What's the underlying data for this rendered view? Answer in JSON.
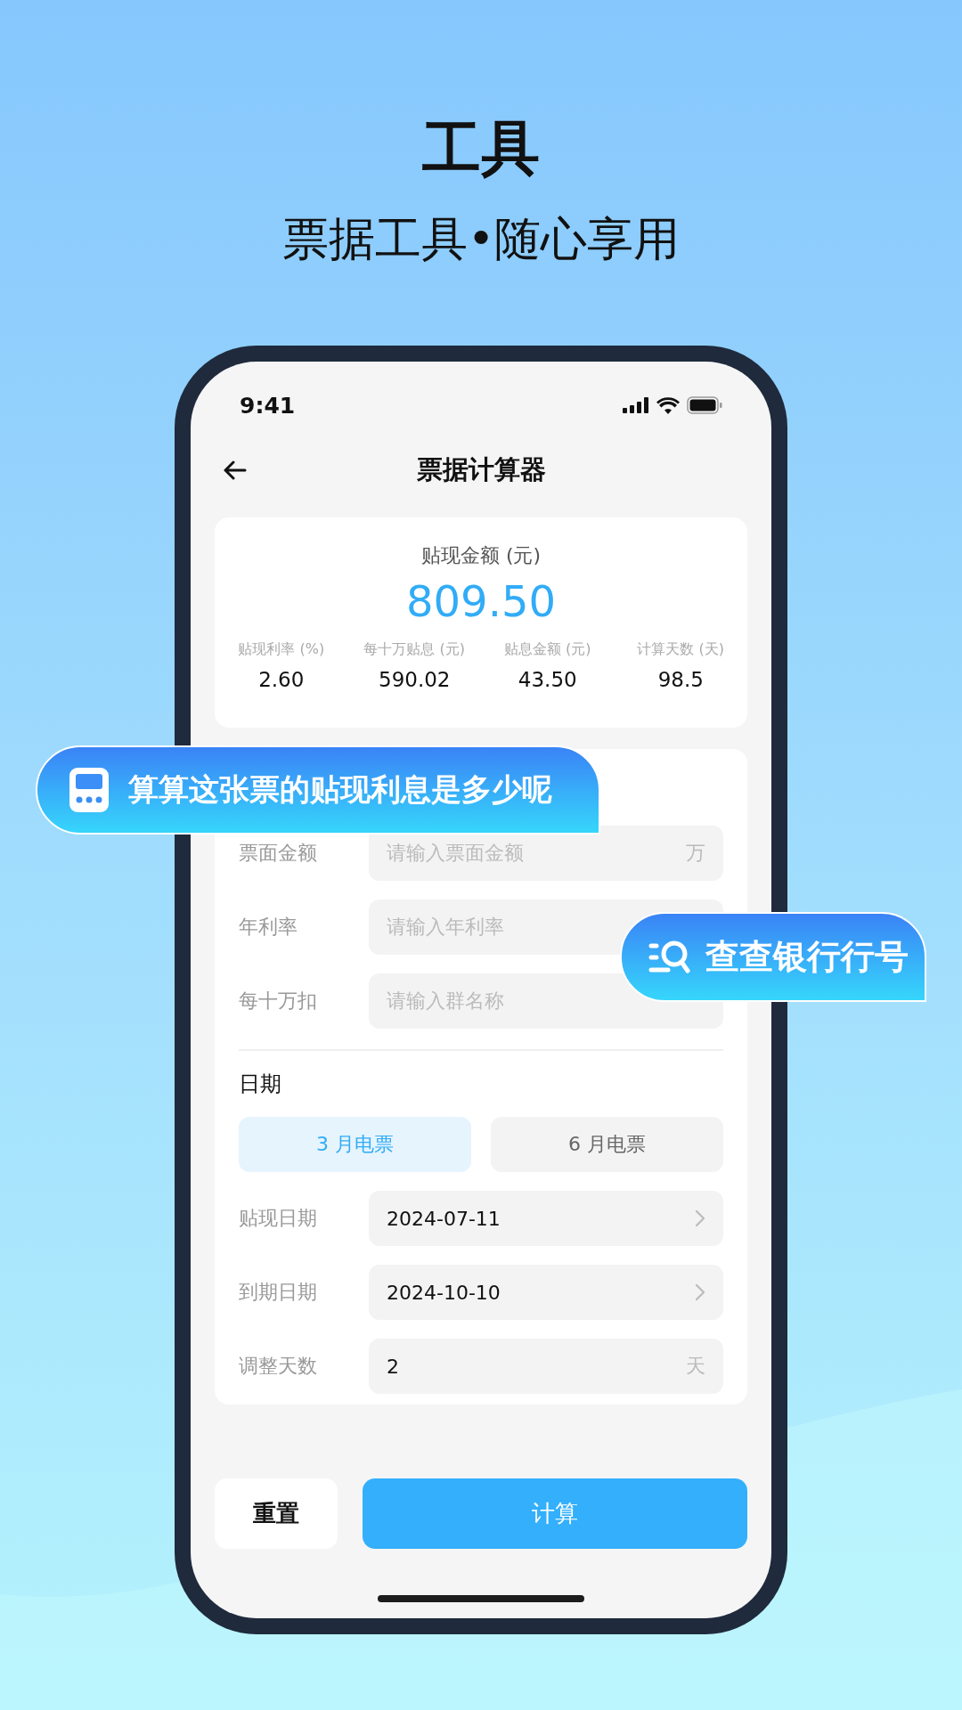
{
  "header": {
    "title": "工具",
    "subtitle": "票据工具•随心享用"
  },
  "status_bar": {
    "time": "9:41"
  },
  "nav": {
    "title": "票据计算器"
  },
  "summary": {
    "label": "贴现金额 (元)",
    "amount": "809.50",
    "stats": [
      {
        "label": "贴现利率 (%)",
        "value": "2.60"
      },
      {
        "label": "每十万贴息 (元)",
        "value": "590.02"
      },
      {
        "label": "贴息金额 (元)",
        "value": "43.50"
      },
      {
        "label": "计算天数 (天)",
        "value": "98.5"
      }
    ]
  },
  "form": {
    "inputs": [
      {
        "label": "票面金额",
        "placeholder": "请输入票面金额",
        "suffix": "万"
      },
      {
        "label": "年利率",
        "placeholder": "请输入年利率"
      },
      {
        "label": "每十万扣",
        "placeholder": "请输入群名称"
      }
    ],
    "date_title": "日期",
    "tabs": [
      {
        "label": "3 月电票",
        "selected": true
      },
      {
        "label": "6 月电票",
        "selected": false
      }
    ],
    "date_rows": [
      {
        "kind": "picker",
        "label": "贴现日期",
        "value": "2024-07-11"
      },
      {
        "kind": "picker",
        "label": "到期日期",
        "value": "2024-10-10"
      },
      {
        "kind": "number",
        "label": "调整天数",
        "value": "2",
        "suffix": "天"
      }
    ]
  },
  "buttons": [
    {
      "kind": "secondary",
      "label": "重置"
    },
    {
      "kind": "primary",
      "label": "计算"
    }
  ],
  "callouts": [
    {
      "kind": "calculator",
      "text": "算算这张票的贴现利息是多少呢"
    },
    {
      "kind": "search",
      "text": "查查银行行号"
    }
  ]
}
